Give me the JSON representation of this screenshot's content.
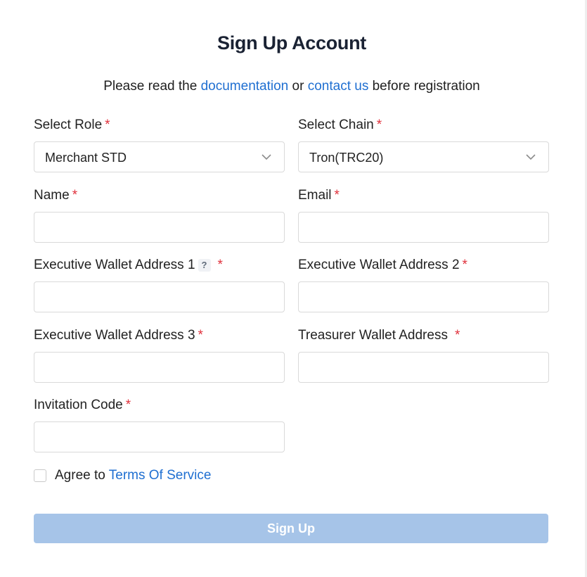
{
  "header": {
    "title": "Sign Up Account",
    "intro_prefix": "Please read the",
    "intro_link1": "documentation",
    "intro_mid": "or",
    "intro_link2": "contact us",
    "intro_suffix": "before registration"
  },
  "form": {
    "required_mark": "*",
    "role": {
      "label": "Select Role",
      "value": "Merchant STD"
    },
    "chain": {
      "label": "Select Chain",
      "value": "Tron(TRC20)"
    },
    "name": {
      "label": "Name",
      "value": ""
    },
    "email": {
      "label": "Email",
      "value": ""
    },
    "wallet1": {
      "label": "Executive Wallet Address 1",
      "help": "?",
      "value": ""
    },
    "wallet2": {
      "label": "Executive Wallet Address 2",
      "value": ""
    },
    "wallet3": {
      "label": "Executive Wallet Address 3",
      "value": ""
    },
    "treasurer": {
      "label": "Treasurer Wallet Address",
      "value": ""
    },
    "invitation": {
      "label": "Invitation Code",
      "value": ""
    },
    "terms": {
      "prefix": "Agree to",
      "link": "Terms Of Service",
      "checked": false
    },
    "submit_label": "Sign Up"
  },
  "colors": {
    "link": "#1f6fd1",
    "required": "#e0313c",
    "button_disabled": "#a6c4e8"
  },
  "icons": {
    "dropdown": "chevron-down-icon",
    "help": "question-mark-icon"
  }
}
